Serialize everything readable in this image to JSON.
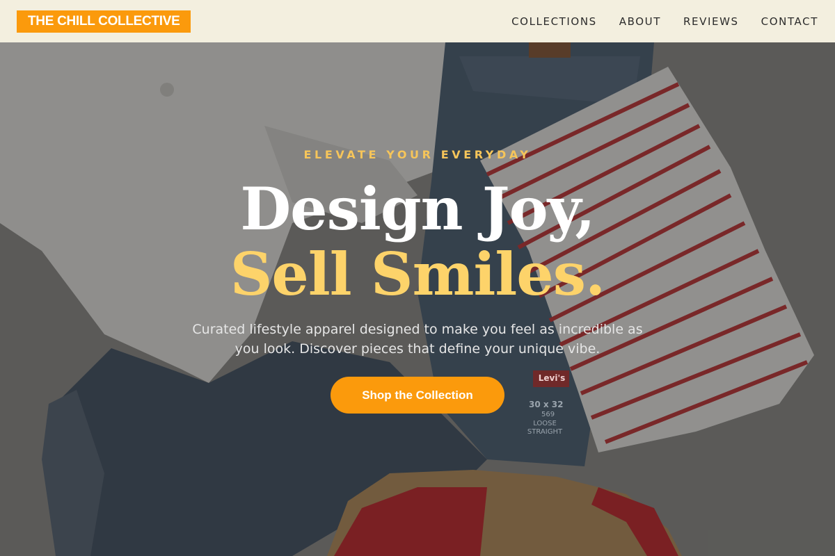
{
  "header": {
    "brand": "THE CHILL COLLECTIVE",
    "nav": [
      {
        "label": "COLLECTIONS"
      },
      {
        "label": "ABOUT"
      },
      {
        "label": "REVIEWS"
      },
      {
        "label": "CONTACT"
      }
    ]
  },
  "hero": {
    "eyebrow": "ELEVATE YOUR EVERYDAY",
    "headline_line1": "Design Joy,",
    "headline_line2": "Sell Smiles.",
    "subtitle": "Curated lifestyle apparel designed to make you feel as incredible as you look. Discover pieces that define your unique vibe.",
    "cta_label": "Shop the Collection",
    "jeans_label": "Levi's",
    "jeans_size": "30 x 32",
    "jeans_model": "569",
    "jeans_fit": "LOOSE STRAIGHT"
  },
  "colors": {
    "brand_orange": "#fb9a0c",
    "header_bg": "#f3efdf",
    "headline_accent": "#fdd36a",
    "eyebrow": "#f6c55a"
  }
}
